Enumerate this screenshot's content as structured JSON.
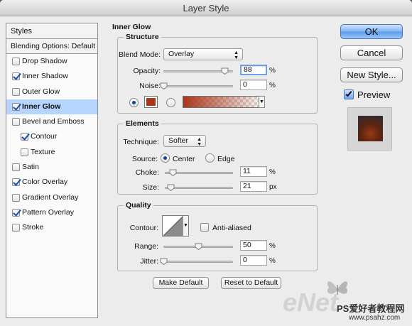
{
  "window": {
    "title": "Layer Style"
  },
  "style_list": {
    "header": "Styles",
    "blending_options": "Blending Options: Default",
    "items": [
      {
        "label": "Drop Shadow",
        "checked": false,
        "sub": false,
        "selected": false
      },
      {
        "label": "Inner Shadow",
        "checked": true,
        "sub": false,
        "selected": false
      },
      {
        "label": "Outer Glow",
        "checked": false,
        "sub": false,
        "selected": false
      },
      {
        "label": "Inner Glow",
        "checked": true,
        "sub": false,
        "selected": true
      },
      {
        "label": "Bevel and Emboss",
        "checked": false,
        "sub": false,
        "selected": false
      },
      {
        "label": "Contour",
        "checked": true,
        "sub": true,
        "selected": false
      },
      {
        "label": "Texture",
        "checked": false,
        "sub": true,
        "selected": false
      },
      {
        "label": "Satin",
        "checked": false,
        "sub": false,
        "selected": false
      },
      {
        "label": "Color Overlay",
        "checked": true,
        "sub": false,
        "selected": false
      },
      {
        "label": "Gradient Overlay",
        "checked": false,
        "sub": false,
        "selected": false
      },
      {
        "label": "Pattern Overlay",
        "checked": true,
        "sub": false,
        "selected": false
      },
      {
        "label": "Stroke",
        "checked": false,
        "sub": false,
        "selected": false
      }
    ]
  },
  "inner_glow": {
    "title": "Inner Glow",
    "structure": {
      "title": "Structure",
      "blend_mode_label": "Blend Mode:",
      "blend_mode_value": "Overlay",
      "opacity_label": "Opacity:",
      "opacity_value": "88",
      "opacity_level": 0.88,
      "opacity_unit": "%",
      "noise_label": "Noise:",
      "noise_value": "0",
      "noise_level": 0,
      "noise_unit": "%",
      "color_swatch": "#a8361a",
      "color_selected": true
    },
    "elements": {
      "title": "Elements",
      "technique_label": "Technique:",
      "technique_value": "Softer",
      "source_label": "Source:",
      "source_center": "Center",
      "source_edge": "Edge",
      "source_selected": "Center",
      "choke_label": "Choke:",
      "choke_value": "11",
      "choke_level": 0.11,
      "choke_unit": "%",
      "size_label": "Size:",
      "size_value": "21",
      "size_level": 0.084,
      "size_unit": "px"
    },
    "quality": {
      "title": "Quality",
      "contour_label": "Contour:",
      "anti_aliased_label": "Anti-aliased",
      "anti_aliased": false,
      "range_label": "Range:",
      "range_value": "50",
      "range_level": 0.5,
      "range_unit": "%",
      "jitter_label": "Jitter:",
      "jitter_value": "0",
      "jitter_level": 0,
      "jitter_unit": "%"
    },
    "make_default": "Make Default",
    "reset_default": "Reset to Default"
  },
  "buttons": {
    "ok": "OK",
    "cancel": "Cancel",
    "new_style": "New Style...",
    "preview_label": "Preview",
    "preview_checked": true
  },
  "watermark": {
    "text": "PS爱好者教程网",
    "url": "www.psahz.com",
    "logo": "eNet"
  },
  "colors": {
    "accent_blue": "#5b9ae8",
    "selection": "#b5d5ff",
    "glow_color": "#a8361a"
  }
}
